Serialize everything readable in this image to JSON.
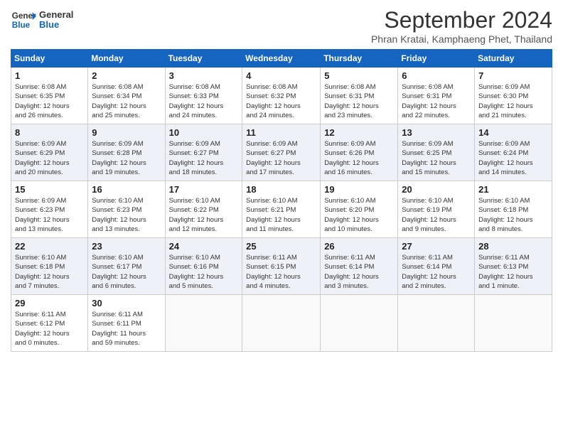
{
  "logo": {
    "line1": "General",
    "line2": "Blue"
  },
  "title": "September 2024",
  "subtitle": "Phran Kratai, Kamphaeng Phet, Thailand",
  "days_of_week": [
    "Sunday",
    "Monday",
    "Tuesday",
    "Wednesday",
    "Thursday",
    "Friday",
    "Saturday"
  ],
  "weeks": [
    [
      {
        "day": "1",
        "info": "Sunrise: 6:08 AM\nSunset: 6:35 PM\nDaylight: 12 hours\nand 26 minutes."
      },
      {
        "day": "2",
        "info": "Sunrise: 6:08 AM\nSunset: 6:34 PM\nDaylight: 12 hours\nand 25 minutes."
      },
      {
        "day": "3",
        "info": "Sunrise: 6:08 AM\nSunset: 6:33 PM\nDaylight: 12 hours\nand 24 minutes."
      },
      {
        "day": "4",
        "info": "Sunrise: 6:08 AM\nSunset: 6:32 PM\nDaylight: 12 hours\nand 24 minutes."
      },
      {
        "day": "5",
        "info": "Sunrise: 6:08 AM\nSunset: 6:31 PM\nDaylight: 12 hours\nand 23 minutes."
      },
      {
        "day": "6",
        "info": "Sunrise: 6:08 AM\nSunset: 6:31 PM\nDaylight: 12 hours\nand 22 minutes."
      },
      {
        "day": "7",
        "info": "Sunrise: 6:09 AM\nSunset: 6:30 PM\nDaylight: 12 hours\nand 21 minutes."
      }
    ],
    [
      {
        "day": "8",
        "info": "Sunrise: 6:09 AM\nSunset: 6:29 PM\nDaylight: 12 hours\nand 20 minutes."
      },
      {
        "day": "9",
        "info": "Sunrise: 6:09 AM\nSunset: 6:28 PM\nDaylight: 12 hours\nand 19 minutes."
      },
      {
        "day": "10",
        "info": "Sunrise: 6:09 AM\nSunset: 6:27 PM\nDaylight: 12 hours\nand 18 minutes."
      },
      {
        "day": "11",
        "info": "Sunrise: 6:09 AM\nSunset: 6:27 PM\nDaylight: 12 hours\nand 17 minutes."
      },
      {
        "day": "12",
        "info": "Sunrise: 6:09 AM\nSunset: 6:26 PM\nDaylight: 12 hours\nand 16 minutes."
      },
      {
        "day": "13",
        "info": "Sunrise: 6:09 AM\nSunset: 6:25 PM\nDaylight: 12 hours\nand 15 minutes."
      },
      {
        "day": "14",
        "info": "Sunrise: 6:09 AM\nSunset: 6:24 PM\nDaylight: 12 hours\nand 14 minutes."
      }
    ],
    [
      {
        "day": "15",
        "info": "Sunrise: 6:09 AM\nSunset: 6:23 PM\nDaylight: 12 hours\nand 13 minutes."
      },
      {
        "day": "16",
        "info": "Sunrise: 6:10 AM\nSunset: 6:23 PM\nDaylight: 12 hours\nand 13 minutes."
      },
      {
        "day": "17",
        "info": "Sunrise: 6:10 AM\nSunset: 6:22 PM\nDaylight: 12 hours\nand 12 minutes."
      },
      {
        "day": "18",
        "info": "Sunrise: 6:10 AM\nSunset: 6:21 PM\nDaylight: 12 hours\nand 11 minutes."
      },
      {
        "day": "19",
        "info": "Sunrise: 6:10 AM\nSunset: 6:20 PM\nDaylight: 12 hours\nand 10 minutes."
      },
      {
        "day": "20",
        "info": "Sunrise: 6:10 AM\nSunset: 6:19 PM\nDaylight: 12 hours\nand 9 minutes."
      },
      {
        "day": "21",
        "info": "Sunrise: 6:10 AM\nSunset: 6:18 PM\nDaylight: 12 hours\nand 8 minutes."
      }
    ],
    [
      {
        "day": "22",
        "info": "Sunrise: 6:10 AM\nSunset: 6:18 PM\nDaylight: 12 hours\nand 7 minutes."
      },
      {
        "day": "23",
        "info": "Sunrise: 6:10 AM\nSunset: 6:17 PM\nDaylight: 12 hours\nand 6 minutes."
      },
      {
        "day": "24",
        "info": "Sunrise: 6:10 AM\nSunset: 6:16 PM\nDaylight: 12 hours\nand 5 minutes."
      },
      {
        "day": "25",
        "info": "Sunrise: 6:11 AM\nSunset: 6:15 PM\nDaylight: 12 hours\nand 4 minutes."
      },
      {
        "day": "26",
        "info": "Sunrise: 6:11 AM\nSunset: 6:14 PM\nDaylight: 12 hours\nand 3 minutes."
      },
      {
        "day": "27",
        "info": "Sunrise: 6:11 AM\nSunset: 6:14 PM\nDaylight: 12 hours\nand 2 minutes."
      },
      {
        "day": "28",
        "info": "Sunrise: 6:11 AM\nSunset: 6:13 PM\nDaylight: 12 hours\nand 1 minute."
      }
    ],
    [
      {
        "day": "29",
        "info": "Sunrise: 6:11 AM\nSunset: 6:12 PM\nDaylight: 12 hours\nand 0 minutes."
      },
      {
        "day": "30",
        "info": "Sunrise: 6:11 AM\nSunset: 6:11 PM\nDaylight: 11 hours\nand 59 minutes."
      },
      {
        "day": "",
        "info": ""
      },
      {
        "day": "",
        "info": ""
      },
      {
        "day": "",
        "info": ""
      },
      {
        "day": "",
        "info": ""
      },
      {
        "day": "",
        "info": ""
      }
    ]
  ]
}
